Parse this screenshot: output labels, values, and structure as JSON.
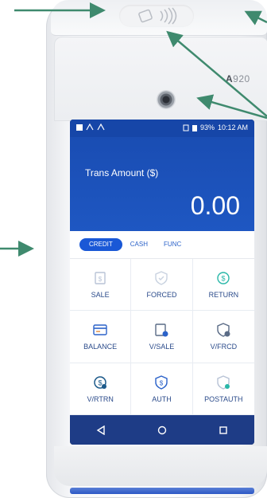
{
  "device": {
    "model_prefix": "A",
    "model_number": "920"
  },
  "status_bar": {
    "battery": "93%",
    "time": "10:12 AM"
  },
  "header": {
    "trans_label": "Trans Amount ($)",
    "amount": "0.00"
  },
  "tabs": [
    {
      "label": "CREDIT",
      "active": true
    },
    {
      "label": "CASH",
      "active": false
    },
    {
      "label": "FUNC",
      "active": false
    }
  ],
  "actions": [
    {
      "label": "SALE",
      "icon": "sale-icon"
    },
    {
      "label": "FORCED",
      "icon": "forced-icon"
    },
    {
      "label": "RETURN",
      "icon": "return-icon"
    },
    {
      "label": "BALANCE",
      "icon": "balance-icon"
    },
    {
      "label": "V/SALE",
      "icon": "void-sale-icon"
    },
    {
      "label": "V/FRCD",
      "icon": "void-forced-icon"
    },
    {
      "label": "V/RTRN",
      "icon": "void-return-icon"
    },
    {
      "label": "AUTH",
      "icon": "auth-icon"
    },
    {
      "label": "POSTAUTH",
      "icon": "postauth-icon"
    }
  ],
  "navbar": {
    "back": "back-icon",
    "home": "home-icon",
    "recents": "recents-icon"
  },
  "colors": {
    "accent": "#1a58d6",
    "header_blue": "#1e57c2",
    "navbar": "#1e3c86",
    "callout_arrow": "#3f8a6e"
  }
}
